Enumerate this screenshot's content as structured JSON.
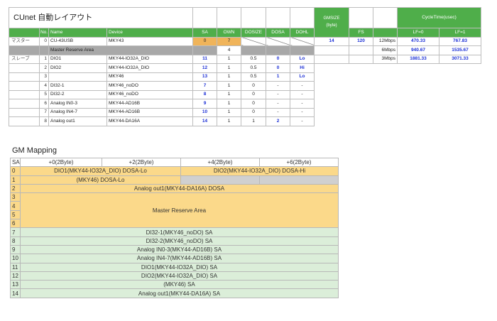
{
  "sheet": {
    "title": "CUnet 自動レイアウト",
    "headers": {
      "no": "No.",
      "name": "Name",
      "device": "Device",
      "sa": "SA",
      "own": "OWN",
      "dosize": "DOSIZE",
      "dosa": "DOSA",
      "dohl": "DOHL",
      "fs": "FS",
      "gmsize": "GMSIZE",
      "gmsize_unit": "(byte)",
      "cycletime": "CycleTime(usec)",
      "lf0": "LF=0",
      "lf1": "LF=1"
    },
    "rows": [
      {
        "role": "マスター",
        "no": "0",
        "name": "CU-43USB",
        "device": "MKY43",
        "sa": "0",
        "own": "7",
        "dosize": "",
        "dosa": "",
        "dohl": ""
      },
      {
        "role": "",
        "no": "",
        "name": "Master Reserve Area",
        "device": "",
        "sa": "",
        "own": "4",
        "dosize": "",
        "dosa": "",
        "dohl": ""
      },
      {
        "role": "スレーブ",
        "no": "1",
        "name": "DIO1",
        "device": "MKY44-IO32A_DIO",
        "sa": "11",
        "own": "1",
        "dosize": "0.5",
        "dosa": "0",
        "dohl": "Lo"
      },
      {
        "role": "",
        "no": "2",
        "name": "DIO2",
        "device": "MKY44-IO32A_DIO",
        "sa": "12",
        "own": "1",
        "dosize": "0.5",
        "dosa": "0",
        "dohl": "Hi"
      },
      {
        "role": "",
        "no": "3",
        "name": "",
        "device": "MKY46",
        "sa": "13",
        "own": "1",
        "dosize": "0.5",
        "dosa": "1",
        "dohl": "Lo"
      },
      {
        "role": "",
        "no": "4",
        "name": "DI32-1",
        "device": "MKY46_noDO",
        "sa": "7",
        "own": "1",
        "dosize": "0",
        "dosa": "-",
        "dohl": "-"
      },
      {
        "role": "",
        "no": "5",
        "name": "DI32-2",
        "device": "MKY46_noDO",
        "sa": "8",
        "own": "1",
        "dosize": "0",
        "dosa": "-",
        "dohl": "-"
      },
      {
        "role": "",
        "no": "6",
        "name": "Analog IN0-3",
        "device": "MKY44-AD16B",
        "sa": "9",
        "own": "1",
        "dosize": "0",
        "dosa": "-",
        "dohl": "-"
      },
      {
        "role": "",
        "no": "7",
        "name": "Analog IN4-7",
        "device": "MKY44-AD16B",
        "sa": "10",
        "own": "1",
        "dosize": "0",
        "dosa": "-",
        "dohl": "-"
      },
      {
        "role": "",
        "no": "8",
        "name": "Analog out1",
        "device": "MKY44-DA16A",
        "sa": "14",
        "own": "1",
        "dosize": "1",
        "dosa": "2",
        "dohl": "-"
      }
    ],
    "fs": "14",
    "gmsize": "120",
    "cycle": [
      {
        "label": "12Mbps",
        "lf0": "470.33",
        "lf1": "767.83"
      },
      {
        "label": "6Mbps",
        "lf0": "940.67",
        "lf1": "1535.67"
      },
      {
        "label": "3Mbps",
        "lf0": "1881.33",
        "lf1": "3071.33"
      }
    ]
  },
  "gm": {
    "title": "GM Mapping",
    "headers": {
      "sa": "SA",
      "c0": "+0(2Byte)",
      "c2": "+2(2Byte)",
      "c4": "+4(2Byte)",
      "c6": "+6(2Byte)"
    },
    "rows": {
      "r0_a": "DIO1(MKY44-IO32A_DIO) DOSA-Lo",
      "r0_b": "DIO2(MKY44-IO32A_DIO) DOSA-Hi",
      "r1_a": "(MKY46) DOSA-Lo",
      "r2": "Analog out1(MKY44-DA16A) DOSA",
      "r3_6": "Master Reserve Area",
      "r7": "DI32-1(MKY46_noDO) SA",
      "r8": "DI32-2(MKY46_noDO) SA",
      "r9": "Analog IN0-3(MKY44-AD16B) SA",
      "r10": "Analog IN4-7(MKY44-AD16B) SA",
      "r11": "DIO1(MKY44-IO32A_DIO) SA",
      "r12": "DIO2(MKY44-IO32A_DIO) SA",
      "r13": "(MKY46) SA",
      "r14": "Analog out1(MKY44-DA16A) SA"
    },
    "sa_numbers": [
      "0",
      "1",
      "2",
      "3",
      "4",
      "5",
      "6",
      "7",
      "8",
      "9",
      "10",
      "11",
      "12",
      "13",
      "14"
    ]
  },
  "colors": {
    "green_header": "#4fae4a",
    "orange": "#f0b45a",
    "light_orange": "#fbd98a",
    "light_green": "#dbeed9",
    "value_blue": "#1b2fd6"
  }
}
